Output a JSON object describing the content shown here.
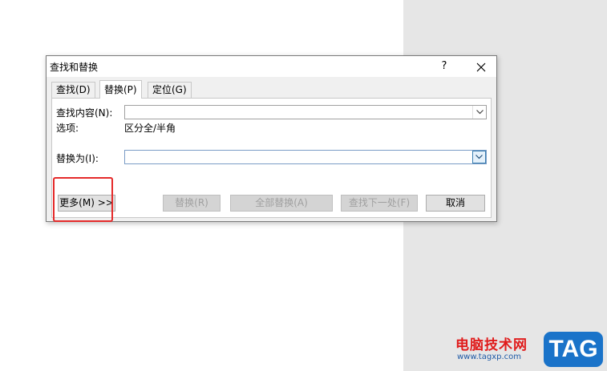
{
  "dialog": {
    "title": "查找和替换",
    "help_label": "?",
    "close_label": "✕",
    "tabs": [
      {
        "label": "查找(D)",
        "active": false
      },
      {
        "label": "替换(P)",
        "active": true
      },
      {
        "label": "定位(G)",
        "active": false
      }
    ],
    "find": {
      "label": "查找内容(N):",
      "value": ""
    },
    "options": {
      "label": "选项:",
      "value": "区分全/半角"
    },
    "replace": {
      "label": "替换为(I):",
      "value": ""
    },
    "buttons": {
      "more": "更多(M) >>",
      "replace": "替换(R)",
      "replace_all": "全部替换(A)",
      "find_next": "查找下一处(F)",
      "cancel": "取消"
    }
  },
  "watermark": {
    "site_name": "电脑技术网",
    "url": "www.tagxp.com",
    "tag": "TAG"
  },
  "colors": {
    "highlight": "#e52a2a",
    "focus": "#3c7fb1",
    "watermark_red": "#e01b1b",
    "watermark_blue": "#1a73c9"
  }
}
